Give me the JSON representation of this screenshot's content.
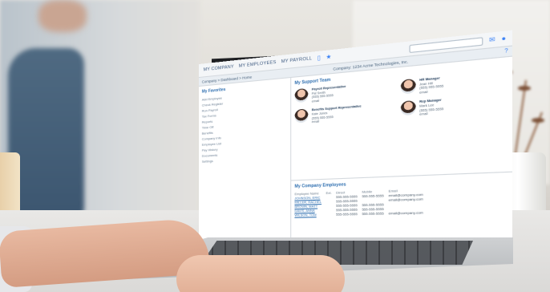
{
  "app": {
    "nav_company": "MY COMPANY",
    "nav_employees": "MY EMPLOYEES",
    "nav_payroll": "MY PAYROLL",
    "search_placeholder": "",
    "breadcrumb": "Company  >  Dashboard  >  Home",
    "company_label": "Company: 1234 Acme Technologies, Inc."
  },
  "sidebar": {
    "title": "My Favorites",
    "items": [
      "Add Employee",
      "Check Register",
      "Run Payroll",
      "Tax Forms",
      "Reports",
      "Time Off",
      "Benefits",
      "Company Info",
      "Employee List",
      "Pay History",
      "Documents",
      "Settings"
    ]
  },
  "support": {
    "title": "My Support Team",
    "members": [
      {
        "role": "Payroll Representative",
        "name": "Pat Smith",
        "phone": "(555) 555-5555",
        "email": "email"
      },
      {
        "role": "HR Manager",
        "name": "Jean Hill",
        "phone": "(555) 555-5555",
        "email": "email"
      },
      {
        "role": "Benefits Support Representative",
        "name": "Kate Jones",
        "phone": "(555) 555-5555",
        "email": "email"
      },
      {
        "role": "Rep Manager",
        "name": "Mark Lee",
        "phone": "(555) 555-5555",
        "email": "email"
      }
    ]
  },
  "employees": {
    "title": "My Company Employees",
    "columns": [
      "Employee Name",
      "Ext.",
      "Direct",
      "Mobile",
      "Email"
    ],
    "rows": [
      [
        "JOHNSON, ERIC",
        "",
        "555-555-5555",
        "555-555-5555",
        "email@company.com"
      ],
      [
        "MILLER, RACHEL",
        "",
        "555-555-5555",
        "",
        "email@company.com"
      ],
      [
        "BROWN, MATT",
        "",
        "555-555-5555",
        "555-555-5555",
        ""
      ],
      [
        "DAVIS, ANNA",
        "",
        "555-555-5555",
        "555-555-5555",
        ""
      ],
      [
        "WILSON, TOM",
        "",
        "555-555-5555",
        "555-555-5555",
        "email@company.com"
      ]
    ]
  }
}
